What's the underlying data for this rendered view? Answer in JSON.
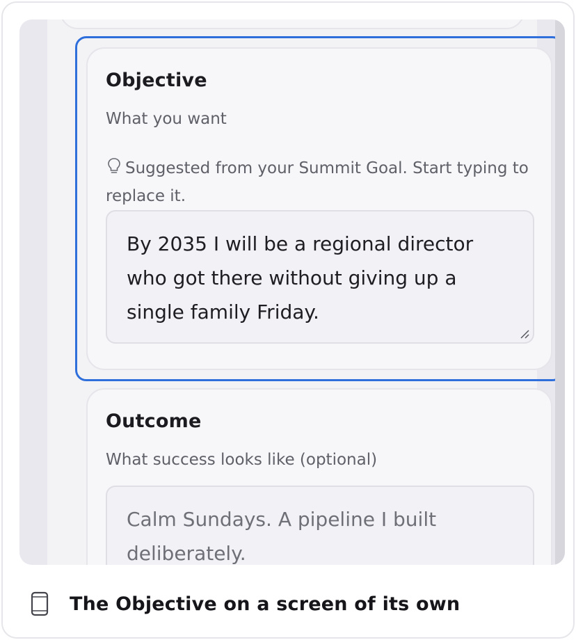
{
  "objective": {
    "title": "Objective",
    "subtitle": "What you want",
    "hint_icon": "lightbulb-icon",
    "hint": "Suggested from your Summit Goal. Start typing to replace it.",
    "value": "By 2035 I will be a regional director who got there without giving up a single family Friday."
  },
  "outcome": {
    "title": "Outcome",
    "subtitle": "What success looks like (optional)",
    "placeholder": "Calm Sundays. A pipeline I built deliberately."
  },
  "caption": {
    "icon": "mobile-phone-icon",
    "text": "The Objective on a screen of its own"
  },
  "colors": {
    "focus": "#2f6fdc",
    "card_bg": "#f7f7fa",
    "muted_text": "#5f6068"
  }
}
